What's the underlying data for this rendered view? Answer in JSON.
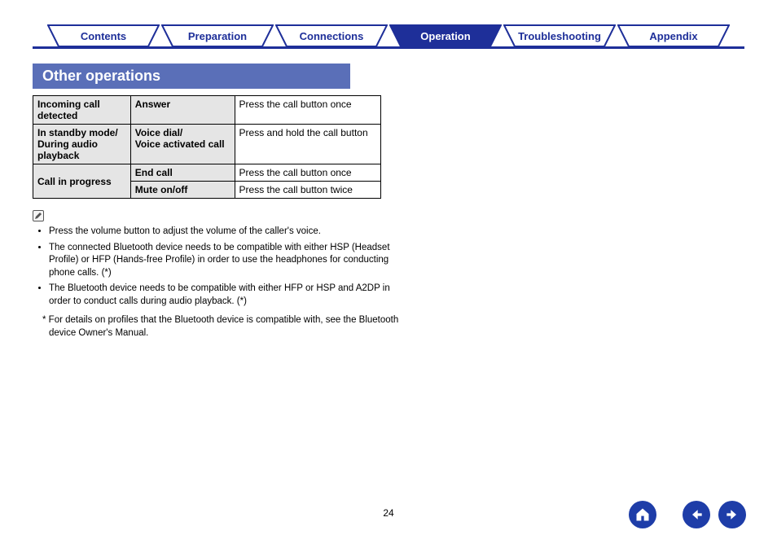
{
  "tabs": [
    {
      "label": "Contents"
    },
    {
      "label": "Preparation"
    },
    {
      "label": "Connections"
    },
    {
      "label": "Operation"
    },
    {
      "label": "Troubleshooting"
    },
    {
      "label": "Appendix"
    }
  ],
  "active_tab": "Operation",
  "section_title": "Other operations",
  "table": {
    "rows": [
      {
        "state": "Incoming call detected",
        "action": "Answer",
        "instruction": "Press the call button once"
      },
      {
        "state": "In standby mode/ During audio playback",
        "action": "Voice dial/\nVoice activated call",
        "instruction": "Press and hold the call button"
      },
      {
        "state": "Call in progress",
        "action": "End call",
        "instruction": "Press the call button once"
      },
      {
        "state": "",
        "action": "Mute on/off",
        "instruction": "Press the call button twice"
      }
    ]
  },
  "notes": {
    "bullet1": "Press the volume button to adjust the volume of the caller's voice.",
    "bullet2": "The connected Bluetooth device needs to be compatible with either HSP (Headset Profile) or HFP (Hands-free Profile) in order to use the headphones for conducting phone calls. (*)",
    "bullet3": "The Bluetooth device needs to be compatible with either HFP or HSP and A2DP in order to conduct calls during audio playback. (*)",
    "asterisk": "* For details on profiles that the Bluetooth device is compatible with, see the Bluetooth device Owner's Manual."
  },
  "page_number": "24",
  "icons": {
    "pencil": "✎",
    "home": "home-icon",
    "prev": "prev-icon",
    "next": "next-icon"
  }
}
